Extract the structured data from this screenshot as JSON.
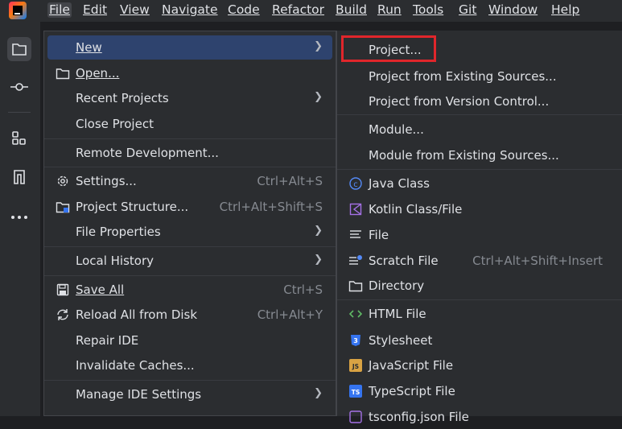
{
  "menubar": {
    "items": [
      "File",
      "Edit",
      "View",
      "Navigate",
      "Code",
      "Refactor",
      "Build",
      "Run",
      "Tools",
      "Git",
      "Window",
      "Help"
    ]
  },
  "file_menu": {
    "new": "New",
    "open": "Open...",
    "recent_projects": "Recent Projects",
    "close_project": "Close Project",
    "remote_development": "Remote Development...",
    "settings": "Settings...",
    "settings_shortcut": "Ctrl+Alt+S",
    "project_structure": "Project Structure...",
    "project_structure_shortcut": "Ctrl+Alt+Shift+S",
    "file_properties": "File Properties",
    "local_history": "Local History",
    "save_all": "Save All",
    "save_all_shortcut": "Ctrl+S",
    "reload_all": "Reload All from Disk",
    "reload_all_shortcut": "Ctrl+Alt+Y",
    "repair_ide": "Repair IDE",
    "invalidate_caches": "Invalidate Caches...",
    "manage_ide_settings": "Manage IDE Settings"
  },
  "new_submenu": {
    "project": "Project...",
    "project_existing": "Project from Existing Sources...",
    "project_vcs": "Project from Version Control...",
    "module": "Module...",
    "module_existing": "Module from Existing Sources...",
    "java_class": "Java Class",
    "kotlin_class": "Kotlin Class/File",
    "file": "File",
    "scratch_file": "Scratch File",
    "scratch_shortcut": "Ctrl+Alt+Shift+Insert",
    "directory": "Directory",
    "html_file": "HTML File",
    "stylesheet": "Stylesheet",
    "javascript_file": "JavaScript File",
    "typescript_file": "TypeScript File",
    "tsconfig_file": "tsconfig.json File"
  },
  "colors": {
    "highlight": "#2e436e",
    "accent_red": "#e0262b",
    "bg": "#2b2d30"
  }
}
